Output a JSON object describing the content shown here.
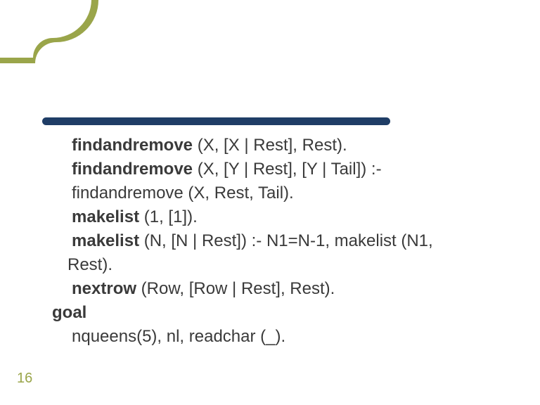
{
  "page_number": "16",
  "lines": {
    "l1a": "findandremove",
    "l1b": " (X, [X | Rest], Rest).",
    "l2a": "findandremove",
    "l2b": " (X, [Y | Rest], [Y | Tail]) :-",
    "l3": " findandremove (X, Rest, Tail).",
    "l4a": "makelist",
    "l4b": " (1, [1]).",
    "l5a": "makelist",
    "l5b": " (N, [N | Rest]) :- N1=N-1, makelist (N1,",
    "l6": " Rest).",
    "l7a": "nextrow",
    "l7b": " (Row, [Row | Rest], Rest).",
    "l8": "goal",
    "l9": "nqueens(5), nl, readchar (_)."
  }
}
